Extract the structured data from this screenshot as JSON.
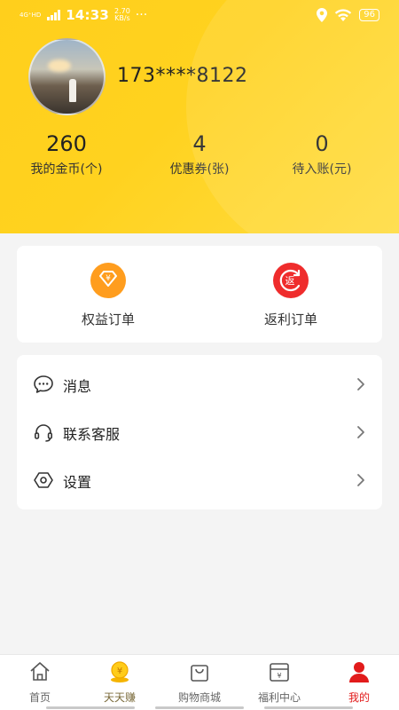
{
  "status": {
    "network": "4G⁺HD",
    "time": "14:33",
    "speed_value": "2.70",
    "speed_unit": "KB/s",
    "battery": "96"
  },
  "profile": {
    "phone": "173****8122"
  },
  "stats": [
    {
      "value": "260",
      "label": "我的金币(个)"
    },
    {
      "value": "4",
      "label": "优惠券(张)"
    },
    {
      "value": "0",
      "label": "待入账(元)"
    }
  ],
  "orders": [
    {
      "label": "权益订单",
      "icon": "yuan-diamond-icon",
      "color": "#ff9d1e"
    },
    {
      "label": "返利订单",
      "icon": "rebate-icon",
      "color": "#ef2c2c"
    }
  ],
  "menu": [
    {
      "label": "消息",
      "icon": "message-icon"
    },
    {
      "label": "联系客服",
      "icon": "headset-icon"
    },
    {
      "label": "设置",
      "icon": "settings-icon"
    }
  ],
  "tabs": [
    {
      "label": "首页",
      "icon": "home-icon"
    },
    {
      "label": "天天赚",
      "icon": "coin-trophy-icon"
    },
    {
      "label": "购物商城",
      "icon": "shopping-bag-icon"
    },
    {
      "label": "福利中心",
      "icon": "welfare-icon"
    },
    {
      "label": "我的",
      "icon": "user-icon",
      "active": true
    }
  ],
  "colors": {
    "header": "#ffd21f",
    "active_tab": "#e21b1b"
  }
}
